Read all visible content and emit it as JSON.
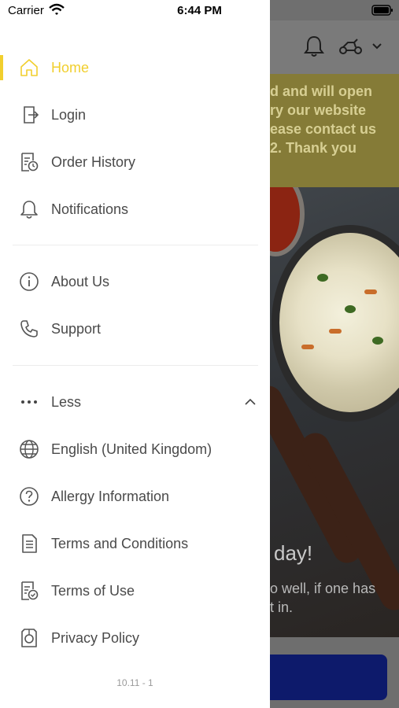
{
  "status_bar": {
    "carrier": "Carrier",
    "time": "6:44 PM"
  },
  "background": {
    "banner_lines": [
      "d and will open",
      "ry our website",
      "ease contact us",
      "2. Thank you"
    ],
    "hero_title": "day!",
    "hero_lines": [
      "o well, if one has",
      "t in."
    ]
  },
  "menu": {
    "main_items": [
      {
        "label": "Home",
        "icon": "home-icon",
        "active": true
      },
      {
        "label": "Login",
        "icon": "login-icon",
        "active": false
      },
      {
        "label": "Order History",
        "icon": "order-history-icon",
        "active": false
      },
      {
        "label": "Notifications",
        "icon": "bell-icon",
        "active": false
      }
    ],
    "info_items": [
      {
        "label": "About Us",
        "icon": "info-icon"
      },
      {
        "label": "Support",
        "icon": "phone-icon"
      }
    ],
    "less_label": "Less",
    "more_items": [
      {
        "label": "English (United Kingdom)",
        "icon": "globe-icon"
      },
      {
        "label": "Allergy Information",
        "icon": "question-icon"
      },
      {
        "label": "Terms and Conditions",
        "icon": "document-icon"
      },
      {
        "label": "Terms of Use",
        "icon": "document-check-icon"
      },
      {
        "label": "Privacy Policy",
        "icon": "privacy-icon"
      }
    ],
    "version": "10.11 - 1"
  },
  "colors": {
    "accent": "#f1cf2e",
    "text": "#4a4a4a",
    "icon": "#555555"
  }
}
